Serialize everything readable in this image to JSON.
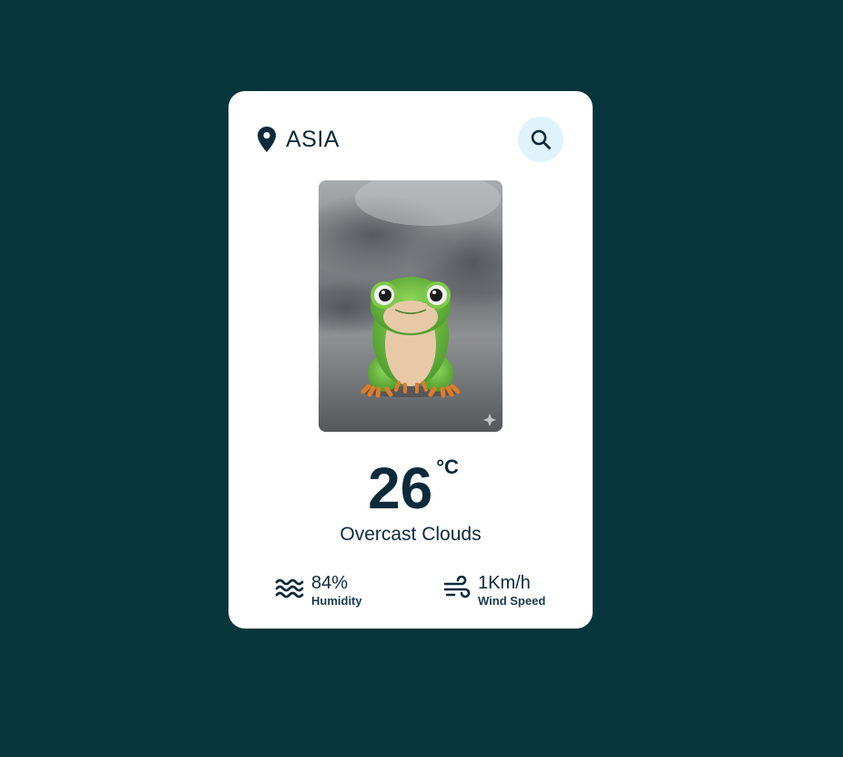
{
  "location": {
    "icon": "location-pin-icon",
    "name": "ASIA"
  },
  "search": {
    "icon": "search-icon"
  },
  "weather": {
    "image": "frog-overcast-illustration",
    "temperature": "26",
    "unit": "°C",
    "description": "Overcast Clouds"
  },
  "stats": {
    "humidity": {
      "icon": "waves-icon",
      "value": "84%",
      "label": "Humidity"
    },
    "wind": {
      "icon": "wind-icon",
      "value": "1Km/h",
      "label": "Wind Speed"
    }
  },
  "colors": {
    "background": "#06363b",
    "card": "#ffffff",
    "text": "#0c2a3a",
    "search_button": "#dff3fb"
  }
}
